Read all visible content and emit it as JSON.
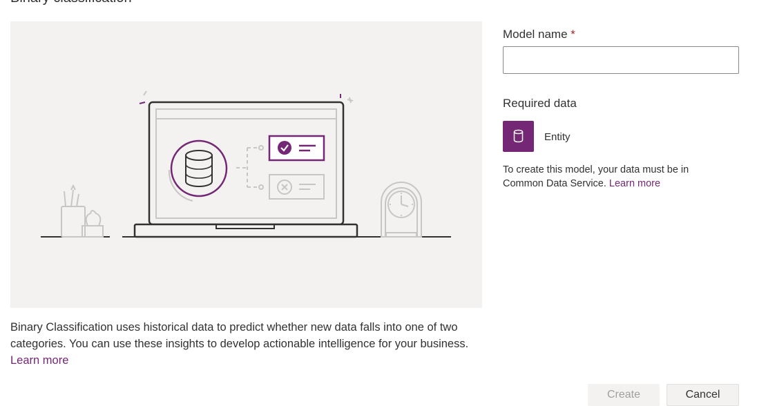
{
  "header": {
    "title": "Binary classification"
  },
  "illustration": {
    "alt": "laptop-database-illustration"
  },
  "description": {
    "text": "Binary Classification uses historical data to predict whether new data falls into one of two categories. You can use these insights to develop actionable intelligence for your business.",
    "link": "Learn more"
  },
  "form": {
    "model_name_label": "Model name",
    "required_marker": "*",
    "model_name_value": "",
    "required_data_label": "Required data",
    "entity_label": "Entity",
    "note_text": "To create this model, your data must be in Common Data Service.",
    "note_link": "Learn more"
  },
  "footer": {
    "create_label": "Create",
    "cancel_label": "Cancel"
  },
  "colors": {
    "accent": "#742774",
    "illustration_bg": "#f3f2f1",
    "text": "#323130",
    "required": "#a4262c"
  }
}
